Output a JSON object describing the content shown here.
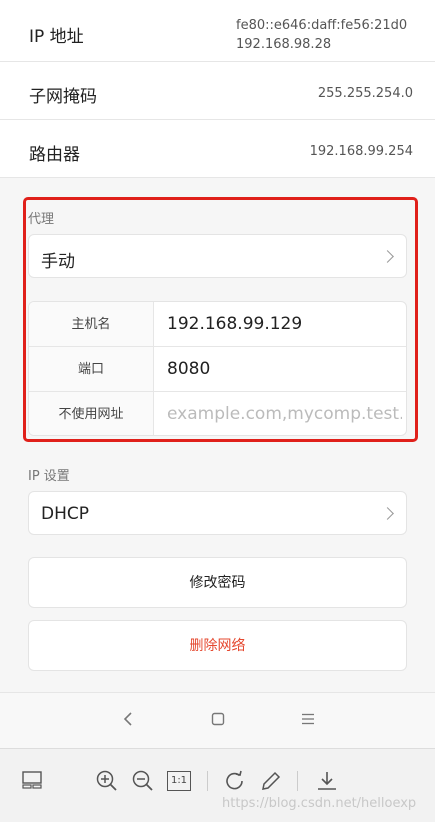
{
  "info": {
    "ip": {
      "label": "IP 地址",
      "value_line1": "fe80::e646:daff:fe56:21d0",
      "value_line2": "192.168.98.28"
    },
    "subnet": {
      "label": "子网掩码",
      "value": "255.255.254.0"
    },
    "router": {
      "label": "路由器",
      "value": "192.168.99.254"
    }
  },
  "proxy": {
    "section_label": "代理",
    "mode": "手动",
    "host": {
      "label": "主机名",
      "value": "192.168.99.129"
    },
    "port": {
      "label": "端口",
      "value": "8080"
    },
    "bypass": {
      "label": "不使用网址",
      "placeholder": "example.com,mycomp.test...."
    }
  },
  "ip_settings": {
    "section_label": "IP 设置",
    "mode": "DHCP"
  },
  "buttons": {
    "modify_password": "修改密码",
    "delete_network": "删除网络"
  },
  "colors": {
    "highlight": "#e0201a",
    "danger": "#e5482f",
    "chevron": "#999999"
  },
  "icons": {
    "nav": [
      "back-icon",
      "home-icon",
      "menu-icon"
    ],
    "toolbar": [
      "layout-icon",
      "zoom-in-icon",
      "zoom-out-icon",
      "actual-size-icon",
      "rotate-icon",
      "edit-icon",
      "download-icon"
    ]
  },
  "toolbar": {
    "actual_size_label": "1:1"
  },
  "watermark": "https://blog.csdn.net/helloexp"
}
